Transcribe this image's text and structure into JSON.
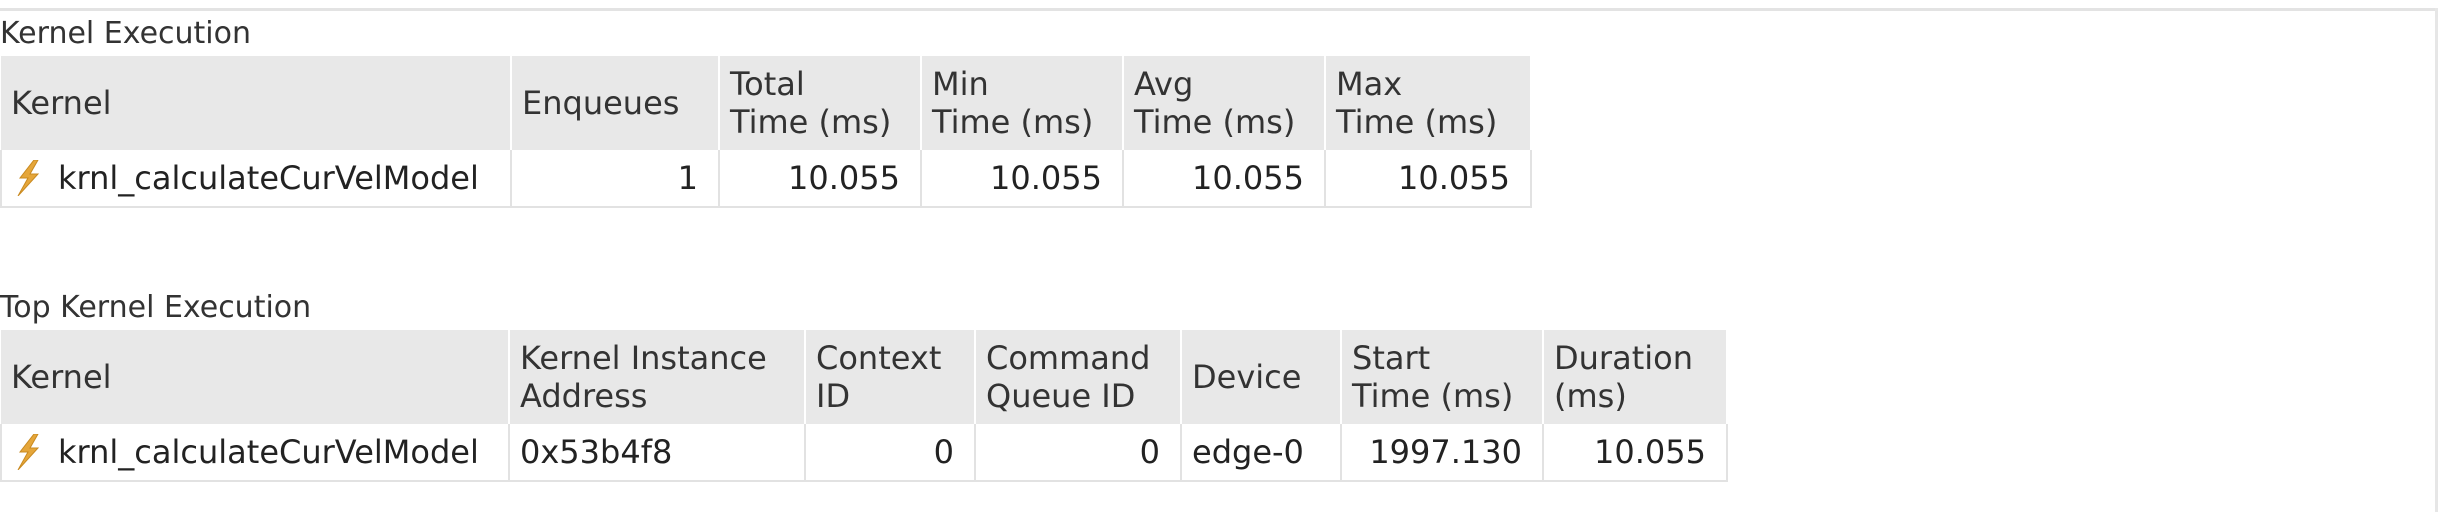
{
  "kernel_execution": {
    "title": "Kernel Execution",
    "headers": [
      "Kernel",
      "Enqueues",
      "Total\nTime (ms)",
      "Min\nTime (ms)",
      "Avg\nTime (ms)",
      "Max\nTime (ms)"
    ],
    "row": {
      "kernel": "krnl_calculateCurVelModel",
      "enqueues": "1",
      "total": "10.055",
      "min": "10.055",
      "avg": "10.055",
      "max": "10.055"
    }
  },
  "top_kernel_execution": {
    "title": "Top Kernel Execution",
    "headers": [
      "Kernel",
      "Kernel Instance\nAddress",
      "Context\nID",
      "Command\nQueue ID",
      "Device",
      "Start\nTime (ms)",
      "Duration\n(ms)"
    ],
    "row": {
      "kernel": "krnl_calculateCurVelModel",
      "address": "0x53b4f8",
      "context_id": "0",
      "queue_id": "0",
      "device": "edge-0",
      "start": "1997.130",
      "duration": "10.055"
    }
  },
  "icons": {
    "kernel_icon": "lightning-bolt-icon"
  },
  "colors": {
    "header_bg": "#e8e8e8",
    "icon": "#e0a030"
  }
}
